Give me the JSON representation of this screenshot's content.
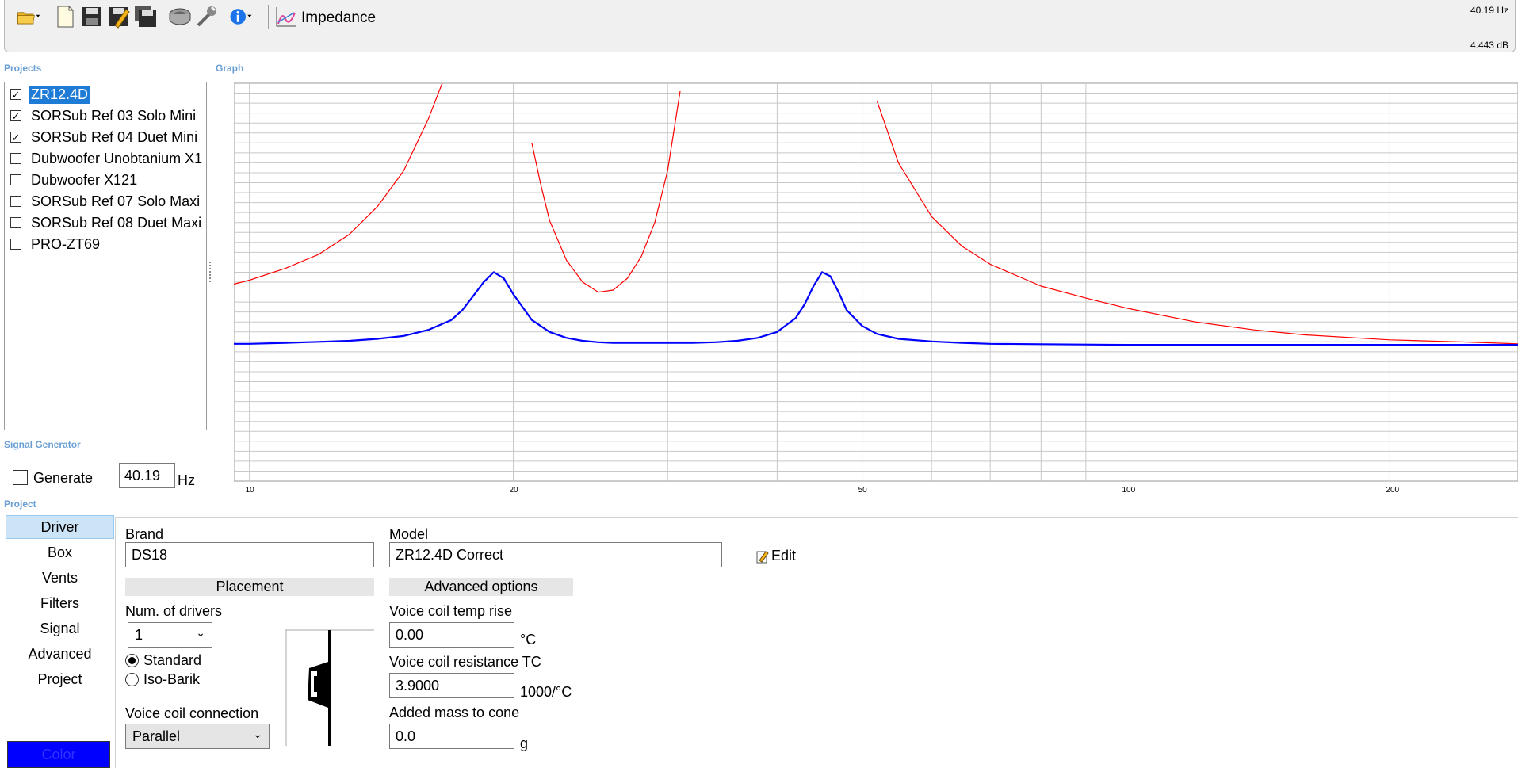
{
  "toolbar": {
    "buttons": [
      "open-folder-icon",
      "new-file-icon",
      "save-icon",
      "save-as-icon",
      "save-all-icon",
      "speaker-icon",
      "wrench-icon",
      "info-icon"
    ],
    "graph_label": "Impedance",
    "readout_freq": "40.19 Hz",
    "readout_db": "4.443 dB"
  },
  "sections": {
    "projects": "Projects",
    "graph": "Graph",
    "signal_generator": "Signal Generator",
    "project": "Project"
  },
  "projects": [
    {
      "label": "ZR12.4D",
      "checked": true,
      "selected": true
    },
    {
      "label": "SORSub Ref 03 Solo Mini",
      "checked": true,
      "selected": false
    },
    {
      "label": "SORSub Ref 04 Duet Mini",
      "checked": true,
      "selected": false
    },
    {
      "label": "Dubwoofer Unobtanium X1",
      "checked": false,
      "selected": false
    },
    {
      "label": "Dubwoofer X121",
      "checked": false,
      "selected": false
    },
    {
      "label": "SORSub Ref 07 Solo Maxi",
      "checked": false,
      "selected": false
    },
    {
      "label": "SORSub Ref 08 Duet Maxi",
      "checked": false,
      "selected": false
    },
    {
      "label": "PRO-ZT69",
      "checked": false,
      "selected": false
    }
  ],
  "signal_generator": {
    "generate_label": "Generate",
    "generate_checked": false,
    "frequency": "40.19",
    "unit": "Hz"
  },
  "side_nav": [
    "Driver",
    "Box",
    "Vents",
    "Filters",
    "Signal",
    "Advanced",
    "Project"
  ],
  "side_nav_active": "Driver",
  "color_button": "Color",
  "driver": {
    "brand_label": "Brand",
    "brand": "DS18",
    "model_label": "Model",
    "model": "ZR12.4D Correct",
    "edit_label": "Edit",
    "placement_label": "Placement",
    "num_drivers_label": "Num. of drivers",
    "num_drivers": "1",
    "radio_standard": "Standard",
    "radio_isobarik": "Iso-Barik",
    "placement_selected": "Standard",
    "vc_connection_label": "Voice coil connection",
    "vc_connection": "Parallel",
    "advanced_label": "Advanced options",
    "vc_temp_label": "Voice coil temp rise",
    "vc_temp": "0.00",
    "vc_temp_unit": "°C",
    "vc_tc_label": "Voice coil resistance TC",
    "vc_tc": "3.9000",
    "vc_tc_unit": "1000/°C",
    "added_mass_label": "Added mass to cone",
    "added_mass": "0.0",
    "added_mass_unit": "g"
  },
  "chart_data": {
    "type": "line",
    "x_scale": "log",
    "xlim": [
      9.6,
      280
    ],
    "ylim": [
      0,
      20
    ],
    "x_tick_labels": [
      "10",
      "20",
      "50",
      "100",
      "200"
    ],
    "x_tick_values": [
      10,
      20,
      50,
      100,
      200
    ],
    "y_ticks": [
      0.5,
      1,
      1.5,
      2,
      2.5,
      3,
      3.5,
      4,
      4.5,
      5,
      5.5,
      6,
      6.5,
      7,
      7.5,
      8,
      8.5,
      9,
      9.5,
      10,
      10.5,
      11,
      11.5,
      12,
      12.5,
      13,
      13.5,
      14,
      14.5,
      15,
      15.5,
      16,
      16.5,
      17,
      17.5,
      18,
      18.5,
      19,
      19.5
    ],
    "grid": true,
    "series": [
      {
        "color": "#ff0000",
        "x": [
          9.6,
          10,
          11,
          12,
          13,
          14,
          15,
          16,
          17,
          17.5,
          18,
          18.5,
          19,
          19.5,
          20,
          20.5,
          21,
          21.5,
          22,
          23,
          24,
          25,
          26,
          27,
          28,
          29,
          30,
          31,
          32,
          33,
          34,
          35,
          36,
          37,
          38,
          39,
          40,
          41,
          42,
          43,
          44,
          45,
          46,
          47,
          48,
          49,
          50,
          52,
          55,
          60,
          65,
          70,
          80,
          90,
          100,
          120,
          140,
          160,
          200,
          240,
          280
        ],
        "y": [
          9.9,
          10.1,
          10.7,
          11.4,
          12.4,
          13.8,
          15.6,
          18.2,
          21.2,
          null,
          null,
          null,
          null,
          null,
          null,
          null,
          17.0,
          14.9,
          13.1,
          11.1,
          10.0,
          9.5,
          9.6,
          10.2,
          11.3,
          13.0,
          15.6,
          19.6,
          null,
          null,
          null,
          null,
          null,
          null,
          null,
          null,
          null,
          null,
          null,
          null,
          null,
          null,
          null,
          null,
          null,
          null,
          null,
          19.1,
          16.0,
          13.3,
          11.8,
          10.9,
          9.8,
          9.2,
          8.7,
          8.0,
          7.6,
          7.35,
          7.1,
          7.0,
          6.9
        ]
      },
      {
        "color": "#0000ff",
        "x": [
          9.6,
          10,
          11,
          12,
          13,
          14,
          15,
          16,
          17,
          17.5,
          18,
          18.5,
          19,
          19.5,
          20,
          21,
          22,
          23,
          24,
          25,
          26,
          27,
          28,
          29,
          30,
          32,
          34,
          36,
          38,
          40,
          42,
          43,
          44,
          45,
          46,
          47,
          48,
          50,
          52,
          55,
          60,
          65,
          70,
          80,
          100,
          140,
          200,
          280
        ],
        "y": [
          6.9,
          6.9,
          6.95,
          7.0,
          7.05,
          7.15,
          7.3,
          7.6,
          8.1,
          8.6,
          9.3,
          10.0,
          10.5,
          10.2,
          9.4,
          8.1,
          7.5,
          7.2,
          7.05,
          6.98,
          6.95,
          6.95,
          6.95,
          6.95,
          6.95,
          6.95,
          6.98,
          7.05,
          7.2,
          7.5,
          8.2,
          8.9,
          9.8,
          10.5,
          10.3,
          9.5,
          8.6,
          7.8,
          7.4,
          7.15,
          7.02,
          6.95,
          6.9,
          6.88,
          6.85,
          6.85,
          6.85,
          6.85
        ]
      }
    ]
  }
}
